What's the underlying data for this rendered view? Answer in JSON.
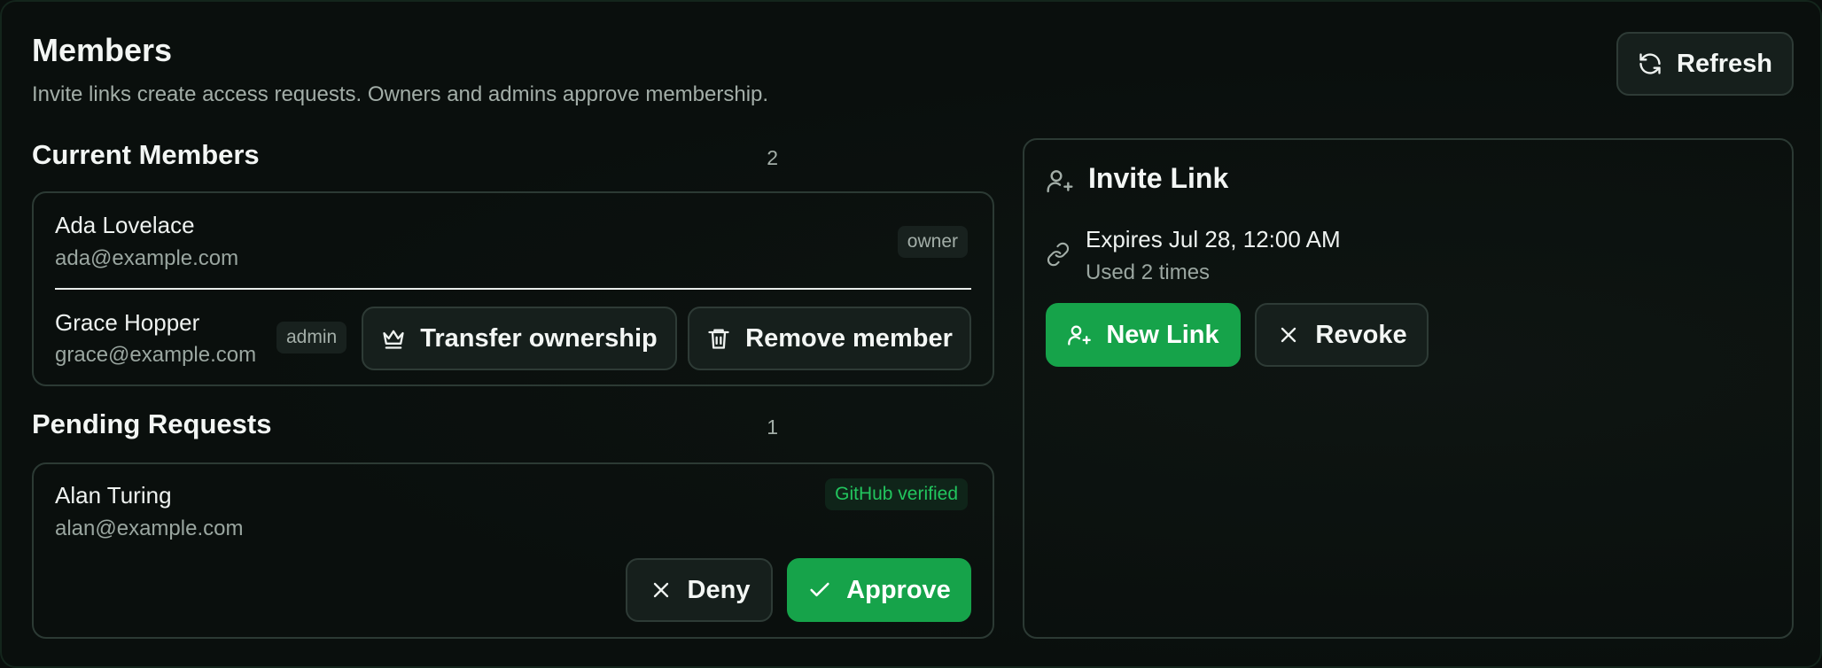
{
  "header": {
    "title": "Members",
    "subtitle": "Invite links create access requests. Owners and admins approve membership.",
    "refresh_label": "Refresh"
  },
  "current_members": {
    "title": "Current Members",
    "count": "2",
    "members": [
      {
        "name": "Ada Lovelace",
        "email": "ada@example.com",
        "role": "owner"
      },
      {
        "name": "Grace Hopper",
        "email": "grace@example.com",
        "role": "admin"
      }
    ],
    "transfer_label": "Transfer ownership",
    "remove_label": "Remove member"
  },
  "pending_requests": {
    "title": "Pending Requests",
    "count": "1",
    "requests": [
      {
        "name": "Alan Turing",
        "email": "alan@example.com",
        "badge": "GitHub verified"
      }
    ],
    "deny_label": "Deny",
    "approve_label": "Approve"
  },
  "invite_link": {
    "title": "Invite Link",
    "expires": "Expires Jul 28, 12:00 AM",
    "usage": "Used 2 times",
    "new_link_label": "New Link",
    "revoke_label": "Revoke"
  },
  "colors": {
    "background": "#0a0f0d",
    "accent_green": "#16a34a",
    "verified_text": "#22c55e"
  },
  "icons": [
    "refresh-icon",
    "crown-icon",
    "trash-icon",
    "close-icon",
    "check-icon",
    "user-plus-icon",
    "link-icon"
  ]
}
